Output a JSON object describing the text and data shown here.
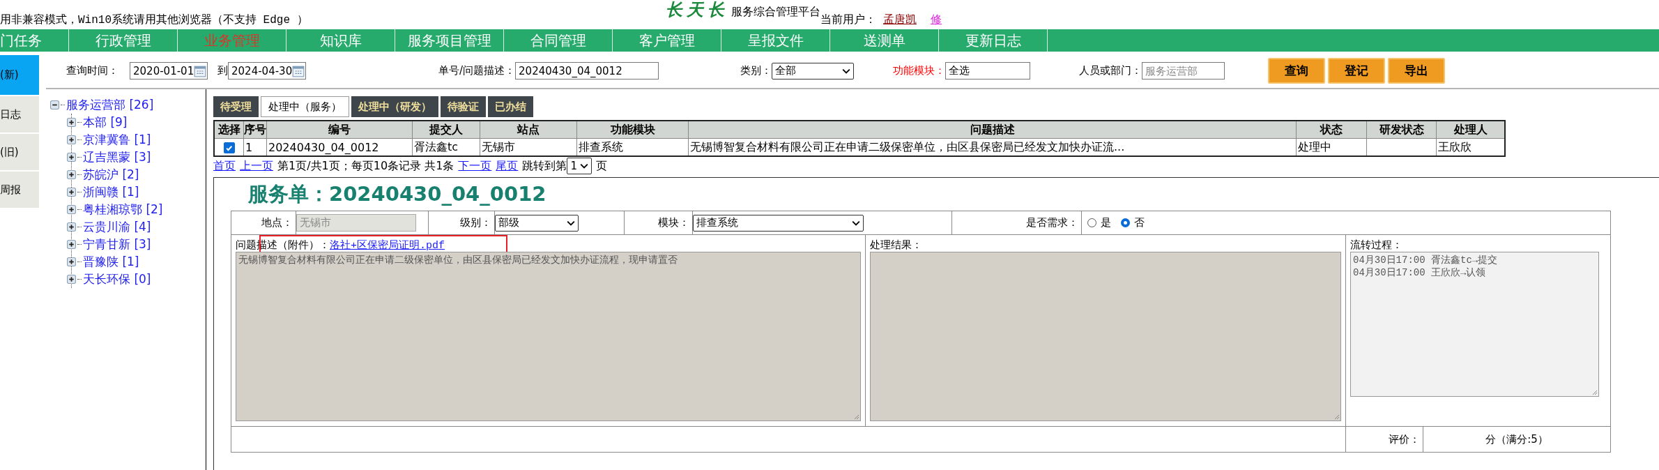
{
  "notice": "用非兼容模式，Win10系统请用其他浏览器（不支持 Edge ）",
  "logo": {
    "brand": "长天长",
    "subtitle": "服务综合管理平台"
  },
  "user": {
    "label": "当前用户：",
    "name": "孟唐凯",
    "action": "修"
  },
  "nav": [
    {
      "label": "门任务",
      "selected": false
    },
    {
      "label": "行政管理",
      "selected": false
    },
    {
      "label": "业务管理",
      "selected": true
    },
    {
      "label": "知识库",
      "selected": false
    },
    {
      "label": "服务项目管理",
      "selected": false
    },
    {
      "label": "合同管理",
      "selected": false
    },
    {
      "label": "客户管理",
      "selected": false
    },
    {
      "label": "呈报文件",
      "selected": false
    },
    {
      "label": "送测单",
      "selected": false
    },
    {
      "label": "更新日志",
      "selected": false
    }
  ],
  "sidebar": [
    {
      "label": "(新)",
      "selected": true
    },
    {
      "label": "日志",
      "selected": false
    },
    {
      "label": "(旧)",
      "selected": false
    },
    {
      "label": "周报",
      "selected": false
    }
  ],
  "filters": {
    "date_label": "查询时间：",
    "date_from": "2020-01-01",
    "date_to_label": "到",
    "date_to": "2024-04-30",
    "number_label": "单号/问题描述：",
    "number_value": "20240430_04_0012",
    "category_label": "类别：",
    "category_value": "全部",
    "module_label": "功能模块：",
    "module_value": "全选",
    "person_label": "人员或部门：",
    "person_placeholder": "服务运营部"
  },
  "buttons": [
    "查询",
    "登记",
    "导出"
  ],
  "tree": {
    "label": "服务运营部 [26]",
    "expanded": true,
    "children": [
      {
        "label": "本部 [9]",
        "expanded": false
      },
      {
        "label": "京津冀鲁 [1]",
        "expanded": false
      },
      {
        "label": "辽吉黑蒙 [3]",
        "expanded": false
      },
      {
        "label": "苏皖沪 [2]",
        "expanded": false
      },
      {
        "label": "浙闽赣 [1]",
        "expanded": false
      },
      {
        "label": "粤桂湘琼鄂 [2]",
        "expanded": false
      },
      {
        "label": "云贵川渝 [4]",
        "expanded": false
      },
      {
        "label": "宁青甘新 [3]",
        "expanded": false
      },
      {
        "label": "晋豫陕 [1]",
        "expanded": false
      },
      {
        "label": "天长环保 [0]",
        "expanded": false
      }
    ]
  },
  "tabs": [
    {
      "label": "待受理",
      "selected": false
    },
    {
      "label": "处理中（服务）",
      "selected": true
    },
    {
      "label": "处理中（研发）",
      "selected": false
    },
    {
      "label": "待验证",
      "selected": false
    },
    {
      "label": "已办结",
      "selected": false
    }
  ],
  "table": {
    "columns": [
      "选择",
      "序号",
      "编号",
      "提交人",
      "站点",
      "功能模块",
      "问题描述",
      "状态",
      "研发状态",
      "处理人"
    ],
    "rows": [
      {
        "checked": true,
        "cells": [
          "",
          "1",
          "20240430_04_0012",
          "胥法鑫tc",
          "无锡市",
          "排查系统",
          "无锡博智复合材料有限公司正在申请二级保密单位，由区县保密局已经发文加快办证流...",
          "处理中",
          "",
          "王欣欣"
        ]
      }
    ]
  },
  "pager": {
    "first": "首页",
    "prev": "上一页",
    "info": "第1页/共1页；每页10条记录 共1条",
    "next": "下一页",
    "last": "尾页",
    "jump_label": "跳转到第",
    "page": "1",
    "page_suffix": "页"
  },
  "detail": {
    "title": "服务单：20240430_04_0012",
    "site_label": "地点：",
    "site_value": "无锡市",
    "level_label": "级别：",
    "level_value": "部级",
    "module_label": "模块：",
    "module_value": "排查系统",
    "demand_label": "是否需求：",
    "demand_options": [
      {
        "label": "是",
        "selected": false
      },
      {
        "label": "否",
        "selected": true
      }
    ],
    "problem_label": "问题描述（附件）：",
    "attachment": "洛社+区保密局证明.pdf",
    "attachment_highlighted": true,
    "problem_text": "无锡博智复合材料有限公司正在申请二级保密单位，由区县保密局已经发文加快办证流程，现申请置否",
    "result_label": "处理结果：",
    "flow_label": "流转过程：",
    "flow_lines": [
      "04月30日17:00 胥法鑫tc→提交",
      "04月30日17:00 王欣欣→认领"
    ],
    "rating_label": "评价：",
    "rating_value": "分（满分:5）"
  }
}
